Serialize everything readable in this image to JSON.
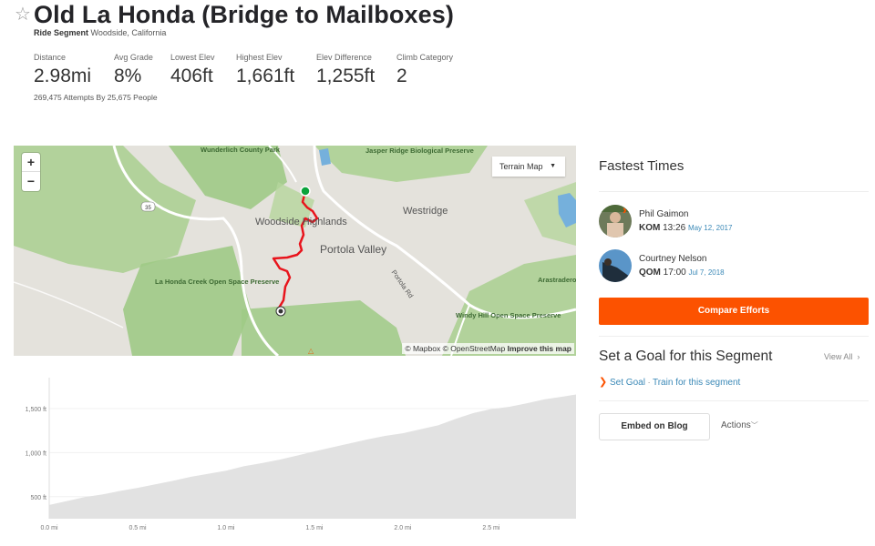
{
  "header": {
    "title": "Old La Honda (Bridge to Mailboxes)",
    "segment_type": "Ride Segment",
    "location": "Woodside, California",
    "attempts_text": "269,475 Attempts By 25,675 People"
  },
  "stats": [
    {
      "label": "Distance",
      "value": "2.98mi"
    },
    {
      "label": "Avg Grade",
      "value": "8%"
    },
    {
      "label": "Lowest Elev",
      "value": "406ft"
    },
    {
      "label": "Highest Elev",
      "value": "1,661ft"
    },
    {
      "label": "Elev Difference",
      "value": "1,255ft"
    },
    {
      "label": "Climb Category",
      "value": "2"
    }
  ],
  "map": {
    "zoom_in": "+",
    "zoom_out": "−",
    "layer_select": "Terrain Map",
    "attribution_mapbox": "© Mapbox",
    "attribution_osm": "© OpenStreetMap",
    "improve_link": "Improve this map",
    "labels": {
      "wunderlich": "Wunderlich County Park",
      "jasper": "Jasper Ridge Biological Preserve",
      "woodside_highlands": "Woodside Highlands",
      "westridge": "Westridge",
      "portola_valley": "Portola Valley",
      "portola_rd": "Portola Rd",
      "la_honda": "La Honda Creek Open Space Preserve",
      "windy_hill": "Windy Hill Open Space Preserve",
      "arastradero": "Arastradero Preserve",
      "route_shield": "35"
    },
    "route_color": "#e8141c",
    "start_color": "#0aa33b"
  },
  "fastest": {
    "title": "Fastest Times",
    "leaders": [
      {
        "name": "Phil Gaimon",
        "badge": "KOM",
        "time": "13:26",
        "date": "May 12, 2017"
      },
      {
        "name": "Courtney Nelson",
        "badge": "QOM",
        "time": "17:00",
        "date": "Jul 7, 2018"
      }
    ],
    "compare_label": "Compare Efforts"
  },
  "goal": {
    "title": "Set a Goal for this Segment",
    "view_all": "View All",
    "set_goal": "Set Goal",
    "separator": "·",
    "train": "Train for this segment"
  },
  "actions": {
    "embed": "Embed on Blog",
    "actions": "Actions"
  },
  "colors": {
    "accent": "#fc5200",
    "link": "#3b89b7"
  },
  "chart_data": {
    "type": "area",
    "title": "",
    "xlabel": "",
    "ylabel": "",
    "x_ticks": [
      "0.0 mi",
      "0.5 mi",
      "1.0 mi",
      "1.5 mi",
      "2.0 mi",
      "2.5 mi"
    ],
    "x_tick_values": [
      0,
      0.5,
      1.0,
      1.5,
      2.0,
      2.5
    ],
    "y_ticks": [
      "500 ft",
      "1,000 ft",
      "1,500 ft"
    ],
    "y_tick_values": [
      500,
      1000,
      1500
    ],
    "xlim": [
      0,
      2.98
    ],
    "ylim": [
      250,
      1800
    ],
    "grid": true,
    "series": [
      {
        "name": "Elevation",
        "x": [
          0,
          0.1,
          0.2,
          0.3,
          0.4,
          0.5,
          0.6,
          0.7,
          0.8,
          0.9,
          1.0,
          1.1,
          1.2,
          1.3,
          1.4,
          1.5,
          1.6,
          1.7,
          1.8,
          1.9,
          2.0,
          2.1,
          2.2,
          2.3,
          2.4,
          2.5,
          2.6,
          2.7,
          2.8,
          2.9,
          2.98
        ],
        "y": [
          406,
          450,
          495,
          525,
          565,
          600,
          640,
          680,
          725,
          760,
          795,
          845,
          880,
          920,
          965,
          1015,
          1060,
          1105,
          1150,
          1190,
          1220,
          1265,
          1310,
          1385,
          1450,
          1495,
          1520,
          1560,
          1605,
          1635,
          1661
        ]
      }
    ]
  }
}
